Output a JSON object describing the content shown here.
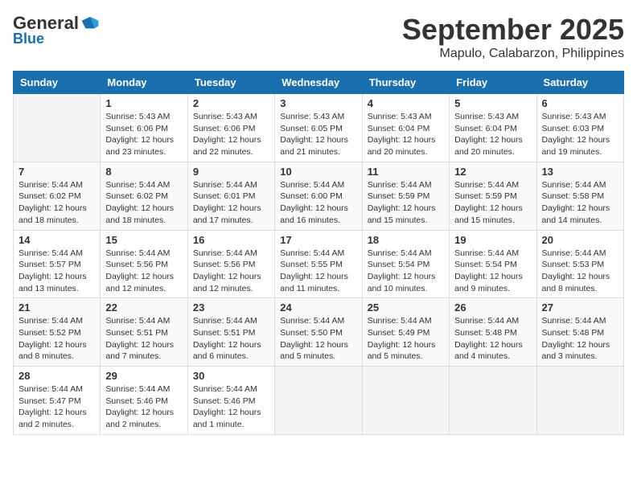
{
  "header": {
    "logo_general": "General",
    "logo_blue": "Blue",
    "month_title": "September 2025",
    "subtitle": "Mapulo, Calabarzon, Philippines"
  },
  "days_of_week": [
    "Sunday",
    "Monday",
    "Tuesday",
    "Wednesday",
    "Thursday",
    "Friday",
    "Saturday"
  ],
  "weeks": [
    [
      {
        "day": "",
        "info": ""
      },
      {
        "day": "1",
        "info": "Sunrise: 5:43 AM\nSunset: 6:06 PM\nDaylight: 12 hours\nand 23 minutes."
      },
      {
        "day": "2",
        "info": "Sunrise: 5:43 AM\nSunset: 6:06 PM\nDaylight: 12 hours\nand 22 minutes."
      },
      {
        "day": "3",
        "info": "Sunrise: 5:43 AM\nSunset: 6:05 PM\nDaylight: 12 hours\nand 21 minutes."
      },
      {
        "day": "4",
        "info": "Sunrise: 5:43 AM\nSunset: 6:04 PM\nDaylight: 12 hours\nand 20 minutes."
      },
      {
        "day": "5",
        "info": "Sunrise: 5:43 AM\nSunset: 6:04 PM\nDaylight: 12 hours\nand 20 minutes."
      },
      {
        "day": "6",
        "info": "Sunrise: 5:43 AM\nSunset: 6:03 PM\nDaylight: 12 hours\nand 19 minutes."
      }
    ],
    [
      {
        "day": "7",
        "info": "Sunrise: 5:44 AM\nSunset: 6:02 PM\nDaylight: 12 hours\nand 18 minutes."
      },
      {
        "day": "8",
        "info": "Sunrise: 5:44 AM\nSunset: 6:02 PM\nDaylight: 12 hours\nand 18 minutes."
      },
      {
        "day": "9",
        "info": "Sunrise: 5:44 AM\nSunset: 6:01 PM\nDaylight: 12 hours\nand 17 minutes."
      },
      {
        "day": "10",
        "info": "Sunrise: 5:44 AM\nSunset: 6:00 PM\nDaylight: 12 hours\nand 16 minutes."
      },
      {
        "day": "11",
        "info": "Sunrise: 5:44 AM\nSunset: 5:59 PM\nDaylight: 12 hours\nand 15 minutes."
      },
      {
        "day": "12",
        "info": "Sunrise: 5:44 AM\nSunset: 5:59 PM\nDaylight: 12 hours\nand 15 minutes."
      },
      {
        "day": "13",
        "info": "Sunrise: 5:44 AM\nSunset: 5:58 PM\nDaylight: 12 hours\nand 14 minutes."
      }
    ],
    [
      {
        "day": "14",
        "info": "Sunrise: 5:44 AM\nSunset: 5:57 PM\nDaylight: 12 hours\nand 13 minutes."
      },
      {
        "day": "15",
        "info": "Sunrise: 5:44 AM\nSunset: 5:56 PM\nDaylight: 12 hours\nand 12 minutes."
      },
      {
        "day": "16",
        "info": "Sunrise: 5:44 AM\nSunset: 5:56 PM\nDaylight: 12 hours\nand 12 minutes."
      },
      {
        "day": "17",
        "info": "Sunrise: 5:44 AM\nSunset: 5:55 PM\nDaylight: 12 hours\nand 11 minutes."
      },
      {
        "day": "18",
        "info": "Sunrise: 5:44 AM\nSunset: 5:54 PM\nDaylight: 12 hours\nand 10 minutes."
      },
      {
        "day": "19",
        "info": "Sunrise: 5:44 AM\nSunset: 5:54 PM\nDaylight: 12 hours\nand 9 minutes."
      },
      {
        "day": "20",
        "info": "Sunrise: 5:44 AM\nSunset: 5:53 PM\nDaylight: 12 hours\nand 8 minutes."
      }
    ],
    [
      {
        "day": "21",
        "info": "Sunrise: 5:44 AM\nSunset: 5:52 PM\nDaylight: 12 hours\nand 8 minutes."
      },
      {
        "day": "22",
        "info": "Sunrise: 5:44 AM\nSunset: 5:51 PM\nDaylight: 12 hours\nand 7 minutes."
      },
      {
        "day": "23",
        "info": "Sunrise: 5:44 AM\nSunset: 5:51 PM\nDaylight: 12 hours\nand 6 minutes."
      },
      {
        "day": "24",
        "info": "Sunrise: 5:44 AM\nSunset: 5:50 PM\nDaylight: 12 hours\nand 5 minutes."
      },
      {
        "day": "25",
        "info": "Sunrise: 5:44 AM\nSunset: 5:49 PM\nDaylight: 12 hours\nand 5 minutes."
      },
      {
        "day": "26",
        "info": "Sunrise: 5:44 AM\nSunset: 5:48 PM\nDaylight: 12 hours\nand 4 minutes."
      },
      {
        "day": "27",
        "info": "Sunrise: 5:44 AM\nSunset: 5:48 PM\nDaylight: 12 hours\nand 3 minutes."
      }
    ],
    [
      {
        "day": "28",
        "info": "Sunrise: 5:44 AM\nSunset: 5:47 PM\nDaylight: 12 hours\nand 2 minutes."
      },
      {
        "day": "29",
        "info": "Sunrise: 5:44 AM\nSunset: 5:46 PM\nDaylight: 12 hours\nand 2 minutes."
      },
      {
        "day": "30",
        "info": "Sunrise: 5:44 AM\nSunset: 5:46 PM\nDaylight: 12 hours\nand 1 minute."
      },
      {
        "day": "",
        "info": ""
      },
      {
        "day": "",
        "info": ""
      },
      {
        "day": "",
        "info": ""
      },
      {
        "day": "",
        "info": ""
      }
    ]
  ]
}
